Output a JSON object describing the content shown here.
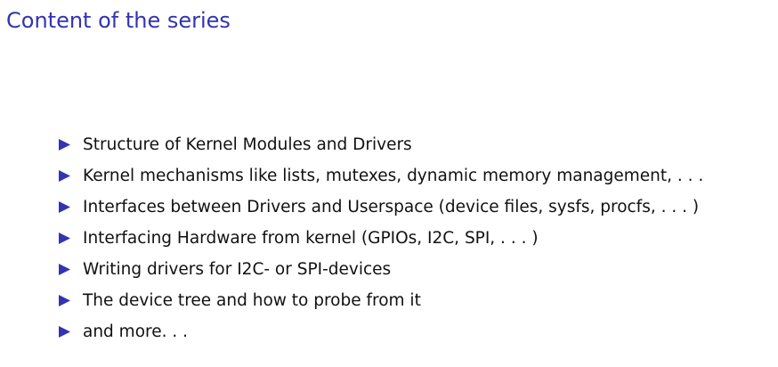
{
  "slide": {
    "title": "Content of the series",
    "accent_color": "#3333b3",
    "bullet_icon": "triangle-right-icon",
    "bullets": [
      "Structure of Kernel Modules and Drivers",
      "Kernel mechanisms like lists, mutexes, dynamic memory management, . . .",
      "Interfaces between Drivers and Userspace (device files, sysfs, procfs, . . . )",
      "Interfacing Hardware from kernel (GPIOs, I2C, SPI, . . . )",
      "Writing drivers for I2C- or SPI-devices",
      "The device tree and how to probe from it",
      "and more. . ."
    ]
  }
}
